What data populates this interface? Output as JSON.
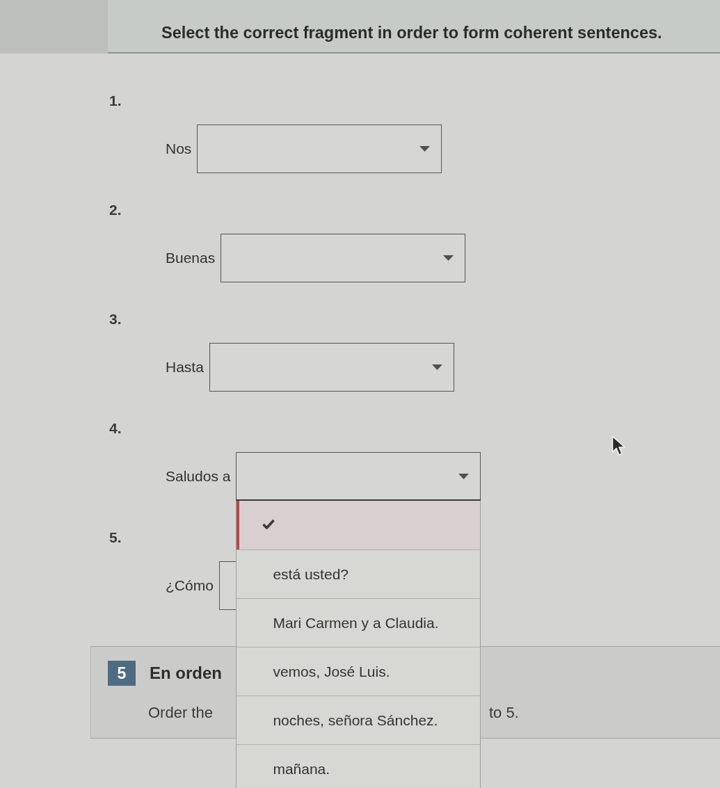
{
  "instructions": "Select the correct fragment in order to form coherent sentences.",
  "questions": [
    {
      "number": "1.",
      "prompt": "Nos",
      "expanded": false
    },
    {
      "number": "2.",
      "prompt": "Buenas",
      "expanded": false
    },
    {
      "number": "3.",
      "prompt": "Hasta",
      "expanded": false
    },
    {
      "number": "4.",
      "prompt": "Saludos a",
      "expanded": true,
      "options": [
        {
          "selected": true
        },
        {
          "label": "está usted?",
          "selected": false
        },
        {
          "label": "Mari Carmen y a Claudia.",
          "selected": false
        },
        {
          "label": "vemos, José Luis.",
          "selected": false
        },
        {
          "label": "noches, señora Sánchez.",
          "selected": false
        },
        {
          "label": "mañana.",
          "selected": false
        }
      ]
    },
    {
      "number": "5.",
      "prompt": "¿Cómo",
      "expanded": false
    }
  ],
  "section": {
    "number": "5",
    "title": "En orden",
    "text_start": "Order the",
    "text_end": "to 5."
  }
}
